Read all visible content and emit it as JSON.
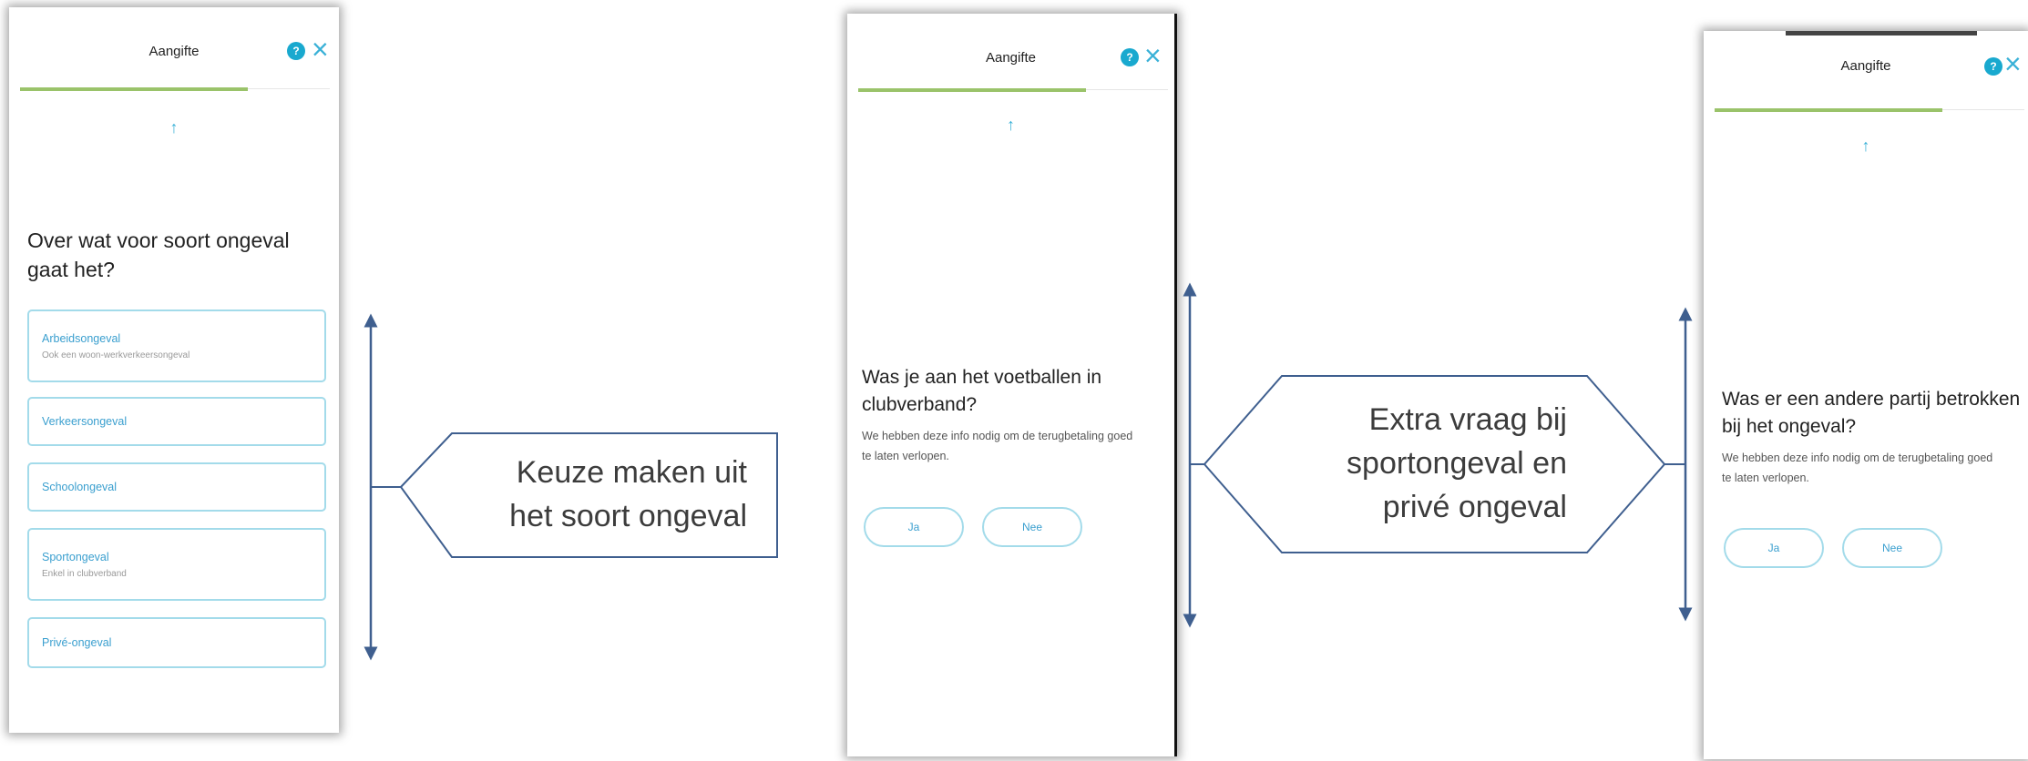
{
  "screens": [
    {
      "header_title": "Aangifte",
      "help_icon": "help-icon",
      "close_icon": "close-icon",
      "question": "Over wat voor soort ongeval gaat het?",
      "options": [
        {
          "label": "Arbeidsongeval",
          "sub": "Ook een woon-werkverkeersongeval"
        },
        {
          "label": "Verkeersongeval",
          "sub": ""
        },
        {
          "label": "Schoolongeval",
          "sub": ""
        },
        {
          "label": "Sportongeval",
          "sub": "Enkel in clubverband"
        },
        {
          "label": "Privé-ongeval",
          "sub": ""
        }
      ]
    },
    {
      "header_title": "Aangifte",
      "question": "Was je aan het voetballen in clubverband?",
      "info": "We hebben deze info nodig om de terugbetaling goed te laten verlopen.",
      "yes_label": "Ja",
      "no_label": "Nee"
    },
    {
      "header_title": "Aangifte",
      "question": "Was er een andere partij betrokken bij het ongeval?",
      "info": "We hebben deze info nodig om de terugbetaling goed te laten verlopen.",
      "yes_label": "Ja",
      "no_label": "Nee"
    }
  ],
  "annotations": [
    {
      "text": "Keuze maken uit het soort ongeval"
    },
    {
      "text": "Extra vraag bij sportongeval en privé ongeval"
    }
  ],
  "colors": {
    "accent": "#3ab1d7",
    "progress": "#9ac36a",
    "option_border": "#a3dbea",
    "annotation_line": "#3f5f8f"
  }
}
